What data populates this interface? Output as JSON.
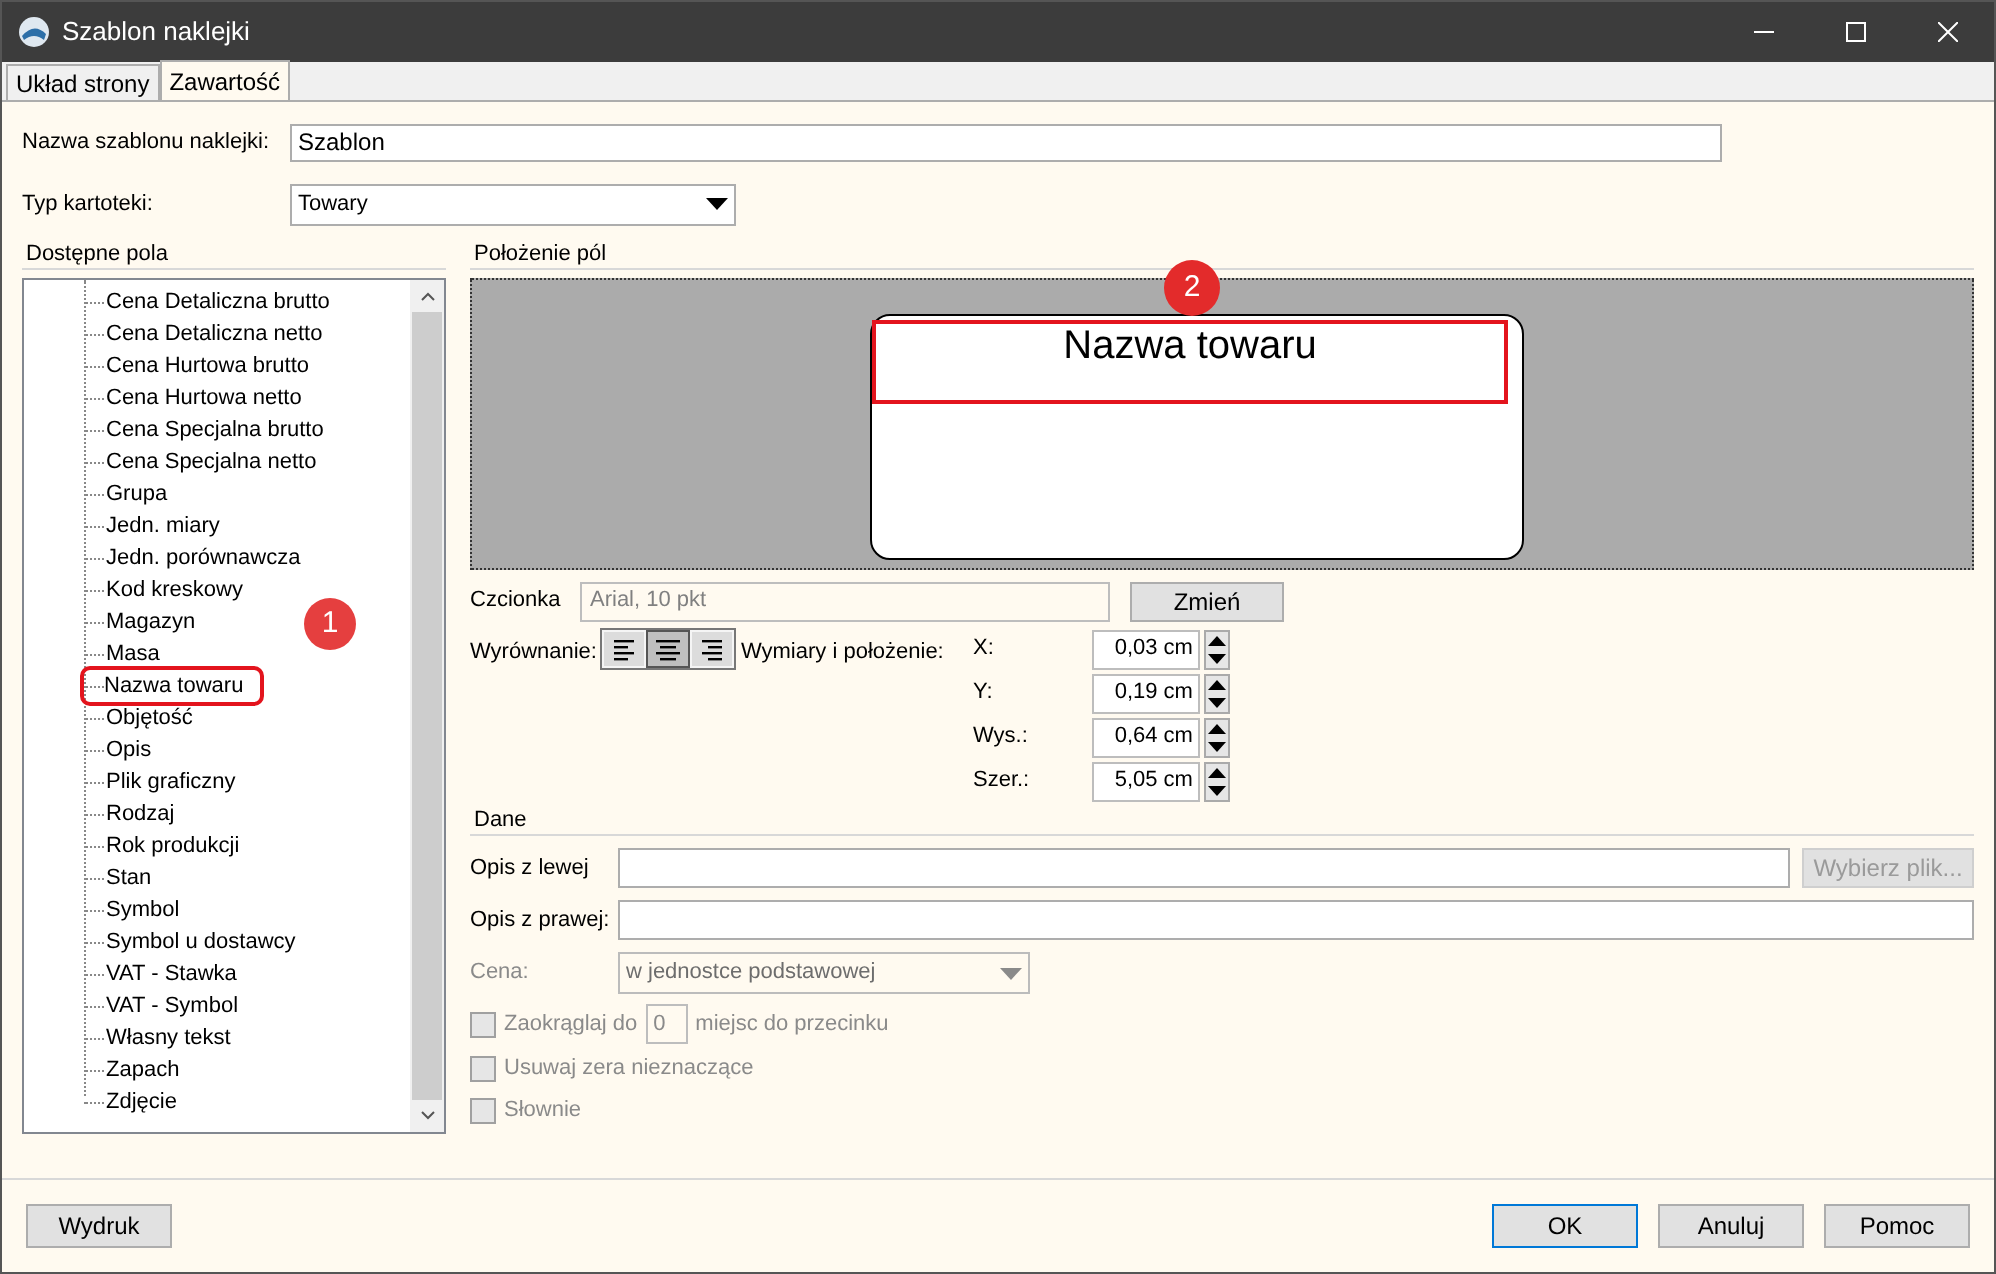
{
  "window": {
    "title": "Szablon naklejki"
  },
  "tabs": [
    {
      "label": "Układ strony",
      "selected": false
    },
    {
      "label": "Zawartość",
      "selected": true
    }
  ],
  "template_name": {
    "label": "Nazwa szablonu naklejki:",
    "value": "Szablon"
  },
  "record_type": {
    "label": "Typ kartoteki:",
    "value": "Towary"
  },
  "available_fields": {
    "title": "Dostępne pola",
    "items": [
      {
        "label": "Cena Detaliczna brutto",
        "highlighted": false
      },
      {
        "label": "Cena Detaliczna netto",
        "highlighted": false
      },
      {
        "label": "Cena Hurtowa brutto",
        "highlighted": false
      },
      {
        "label": "Cena Hurtowa netto",
        "highlighted": false
      },
      {
        "label": "Cena Specjalna brutto",
        "highlighted": false
      },
      {
        "label": "Cena Specjalna netto",
        "highlighted": false
      },
      {
        "label": "Grupa",
        "highlighted": false
      },
      {
        "label": "Jedn. miary",
        "highlighted": false
      },
      {
        "label": "Jedn. porównawcza",
        "highlighted": false
      },
      {
        "label": "Kod kreskowy",
        "highlighted": false
      },
      {
        "label": "Magazyn",
        "highlighted": false
      },
      {
        "label": "Masa",
        "highlighted": false
      },
      {
        "label": "Nazwa towaru",
        "highlighted": true,
        "badge": "1"
      },
      {
        "label": "Objętość",
        "highlighted": false
      },
      {
        "label": "Opis",
        "highlighted": false
      },
      {
        "label": "Plik graficzny",
        "highlighted": false
      },
      {
        "label": "Rodzaj",
        "highlighted": false
      },
      {
        "label": "Rok produkcji",
        "highlighted": false
      },
      {
        "label": "Stan",
        "highlighted": false
      },
      {
        "label": "Symbol",
        "highlighted": false
      },
      {
        "label": "Symbol u dostawcy",
        "highlighted": false
      },
      {
        "label": "VAT - Stawka",
        "highlighted": false
      },
      {
        "label": "VAT - Symbol",
        "highlighted": false
      },
      {
        "label": "Własny tekst",
        "highlighted": false
      },
      {
        "label": "Zapach",
        "highlighted": false
      },
      {
        "label": "Zdjęcie",
        "highlighted": false
      }
    ]
  },
  "layout": {
    "title": "Położenie pól",
    "field_text": "Nazwa towaru",
    "badge": "2"
  },
  "font": {
    "label": "Czcionka",
    "value": "Arial, 10 pkt",
    "disabled": true,
    "button": "Zmień"
  },
  "alignment": {
    "label": "Wyrównanie:",
    "options": [
      {
        "kind": "left",
        "selected": false
      },
      {
        "kind": "center",
        "selected": true
      },
      {
        "kind": "right",
        "selected": false
      }
    ]
  },
  "dimensions": {
    "label": "Wymiary i położenie:",
    "fields": [
      {
        "label": "X:",
        "value": "0,03 cm"
      },
      {
        "label": "Y:",
        "value": "0,19 cm"
      },
      {
        "label": "Wys.:",
        "value": "0,64 cm"
      },
      {
        "label": "Szer.:",
        "value": "5,05 cm"
      }
    ]
  },
  "data": {
    "title": "Dane",
    "left_label": "Opis z lewej",
    "choose_file": "Wybierz plik...",
    "right_label": "Opis z prawej:",
    "price": {
      "label": "Cena:",
      "value": "w jednostce podstawowej",
      "disabled": true
    },
    "round": {
      "label": "Zaokrąglaj do",
      "value": "0",
      "suffix": "miejsc do przecinku",
      "checked": false,
      "disabled": true
    },
    "options": [
      {
        "label": "Usuwaj zera nieznaczące",
        "checked": false,
        "disabled": true
      },
      {
        "label": "Słownie",
        "checked": false,
        "disabled": true
      }
    ]
  },
  "buttons": {
    "print": "Wydruk",
    "ok": "OK",
    "cancel": "Anuluj",
    "help": "Pomoc"
  }
}
